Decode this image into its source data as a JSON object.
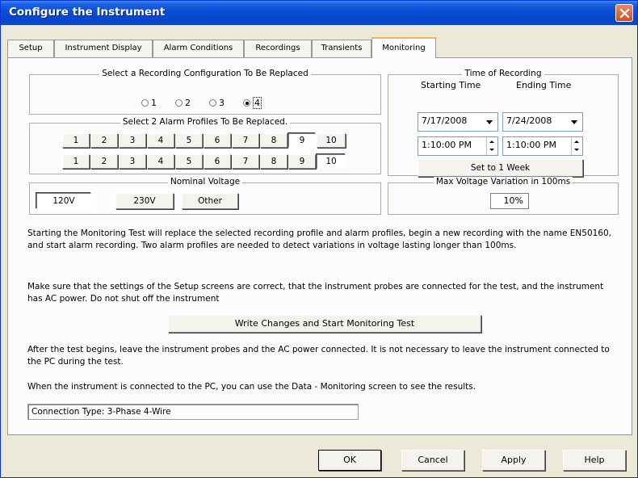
{
  "window": {
    "title": "Configure the Instrument",
    "close_icon": "close-icon"
  },
  "tabs": [
    "Setup",
    "Instrument Display",
    "Alarm Conditions",
    "Recordings",
    "Transients",
    "Monitoring"
  ],
  "active_tab": "Monitoring",
  "recording_config": {
    "title": "Select a Recording Configuration To Be Replaced",
    "options": [
      "1",
      "2",
      "3",
      "4"
    ],
    "selected": "4"
  },
  "alarm_profiles": {
    "title": "Select 2 Alarm Profiles To Be Replaced.",
    "row1": [
      "1",
      "2",
      "3",
      "4",
      "5",
      "6",
      "7",
      "8",
      "9",
      "10"
    ],
    "row2": [
      "1",
      "2",
      "3",
      "4",
      "5",
      "6",
      "7",
      "8",
      "9",
      "10"
    ],
    "row1_selected": "9",
    "row2_selected": "10"
  },
  "nominal_voltage": {
    "title": "Nominal Voltage",
    "options": [
      "120V",
      "230V",
      "Other"
    ],
    "selected": "120V"
  },
  "time_of_recording": {
    "title": "Time of Recording",
    "start_label": "Starting Time",
    "end_label": "Ending Time",
    "start_date": "7/17/2008",
    "end_date": "7/24/2008",
    "start_time": "1:10:00 PM",
    "end_time": "1:10:00 PM",
    "week_button": "Set to 1 Week"
  },
  "max_variation": {
    "title": "Max Voltage Variation in 100ms",
    "value": "10%"
  },
  "text": {
    "para1": "Starting the Monitoring Test will replace the selected recording profile and alarm profiles, begin a new recording with the name EN50160, and start alarm recording. Two alarm profiles are needed to detect variations in voltage lasting longer than 100ms.",
    "para2": "Make sure that the settings of the Setup screens are correct, that the instrument probes are connected for the test, and the instrument has AC power. Do not shut off the instrument",
    "start_button": "Write Changes and Start Monitoring Test",
    "para3": "After the test begins, leave the instrument probes and the AC power connected. It is not necessary to leave the instrument connected to the PC during the test.",
    "para4": "When the instrument is connected to the PC, you can use the Data - Monitoring screen to see the results.",
    "connection": "Connection Type: 3-Phase 4-Wire"
  },
  "buttons": {
    "ok": "OK",
    "cancel": "Cancel",
    "apply": "Apply",
    "help": "Help"
  },
  "colors": {
    "titlebar": "#0a4fd8",
    "active_tab_accent": "#f1b64c",
    "close_button": "#d5491f"
  }
}
